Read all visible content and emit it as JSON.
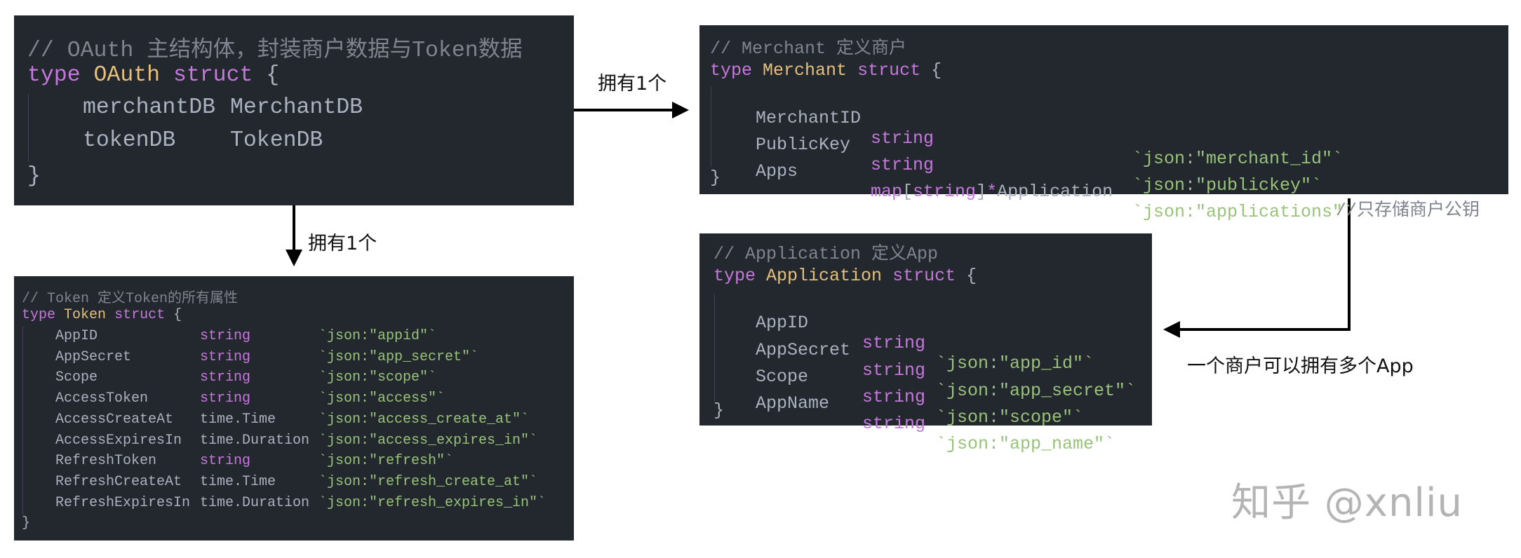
{
  "oauth": {
    "comment": "// OAuth 主结构体，封装商户数据与Token数据",
    "kw_type": "type",
    "name": "OAuth",
    "kw_struct": "struct",
    "open": "{",
    "close": "}",
    "fields": [
      {
        "name": "merchantDB",
        "type": "MerchantDB"
      },
      {
        "name": "tokenDB",
        "type": "TokenDB"
      }
    ]
  },
  "merchant": {
    "comment": "// Merchant 定义商户",
    "kw_type": "type",
    "name": "Merchant",
    "kw_struct": "struct",
    "open": "{",
    "close": "}",
    "fields": [
      {
        "name": "MerchantID",
        "type": "string",
        "tag": "`json:\"merchant_id\"`",
        "comment": ""
      },
      {
        "name": "PublicKey",
        "type": "string",
        "tag": "`json:\"publickey\"`",
        "comment": "//只存储商户公钥"
      },
      {
        "name": "Apps",
        "type_parts": {
          "map": "map",
          "lb": "[",
          "key": "string",
          "rb": "]",
          "star": "*",
          "val": "Application"
        },
        "tag": "`json:\"applications\"`",
        "comment": ""
      }
    ]
  },
  "application": {
    "comment": "// Application 定义App",
    "kw_type": "type",
    "name": "Application",
    "kw_struct": "struct",
    "open": "{",
    "close": "}",
    "fields": [
      {
        "name": "AppID",
        "type": "string",
        "tag": "`json:\"app_id\"`"
      },
      {
        "name": "AppSecret",
        "type": "string",
        "tag": "`json:\"app_secret\"`"
      },
      {
        "name": "Scope",
        "type": "string",
        "tag": "`json:\"scope\"`"
      },
      {
        "name": "AppName",
        "type": "string",
        "tag": "`json:\"app_name\"`"
      }
    ]
  },
  "token": {
    "comment": "// Token 定义Token的所有属性",
    "kw_type": "type",
    "name": "Token",
    "kw_struct": "struct",
    "open": "{",
    "close": "}",
    "fields": [
      {
        "name": "AppID",
        "type": "string",
        "builtin": true,
        "tag": "`json:\"appid\"`"
      },
      {
        "name": "AppSecret",
        "type": "string",
        "builtin": true,
        "tag": "`json:\"app_secret\"`"
      },
      {
        "name": "Scope",
        "type": "string",
        "builtin": true,
        "tag": "`json:\"scope\"`"
      },
      {
        "name": "AccessToken",
        "type": "string",
        "builtin": true,
        "tag": "`json:\"access\"`"
      },
      {
        "name": "AccessCreateAt",
        "type": "time.Time",
        "builtin": false,
        "tag": "`json:\"access_create_at\"`"
      },
      {
        "name": "AccessExpiresIn",
        "type": "time.Duration",
        "builtin": false,
        "tag": "`json:\"access_expires_in\"`"
      },
      {
        "name": "RefreshToken",
        "type": "string",
        "builtin": true,
        "tag": "`json:\"refresh\"`"
      },
      {
        "name": "RefreshCreateAt",
        "type": "time.Time",
        "builtin": false,
        "tag": "`json:\"refresh_create_at\"`"
      },
      {
        "name": "RefreshExpiresIn",
        "type": "time.Duration",
        "builtin": false,
        "tag": "`json:\"refresh_expires_in\"`"
      }
    ]
  },
  "edges": {
    "oauth_to_merchant": "拥有1个",
    "oauth_to_token": "拥有1个",
    "merchant_to_application": "一个商户可以拥有多个App"
  },
  "colors": {
    "background": "#23272e",
    "keyword": "#c678dd",
    "type_name": "#e5c07b",
    "comment": "#7f848e",
    "string_tag": "#98c379",
    "plain": "#abb2bf"
  },
  "watermark": "知乎 @xnliu"
}
